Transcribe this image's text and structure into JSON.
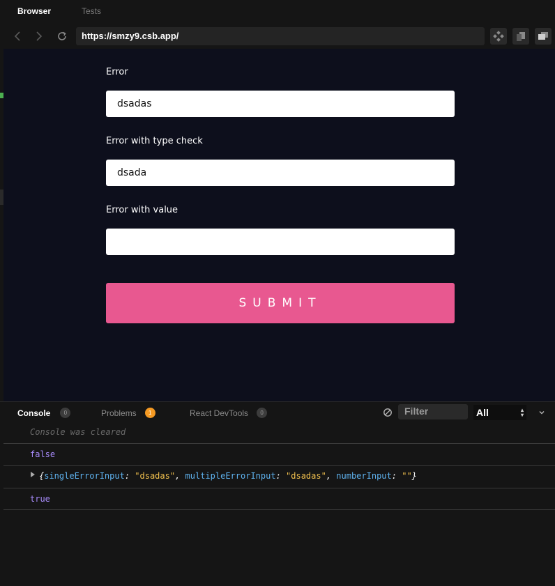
{
  "top_tabs": {
    "browser": "Browser",
    "tests": "Tests"
  },
  "navbar": {
    "url": "https://smzy9.csb.app/"
  },
  "form": {
    "error_label": "Error",
    "error_value": "dsadas",
    "type_check_label": "Error with type check",
    "type_check_value": "dsada",
    "value_label": "Error with value",
    "value_value": "",
    "submit_label": "SUBMIT"
  },
  "console": {
    "tabs": [
      {
        "label": "Console",
        "count": "0"
      },
      {
        "label": "Problems",
        "count": "1"
      },
      {
        "label": "React DevTools",
        "count": "0"
      }
    ],
    "filter_placeholder": "Filter",
    "level": "All",
    "lines": {
      "cleared": "Console was cleared",
      "first": "false",
      "obj_open": "{",
      "k1": "singleErrorInput",
      "v1": "\"dsadas\"",
      "k2": "multipleErrorInput",
      "v2": "\"dsadas\"",
      "k3": "numberInput",
      "v3": "\"\"",
      "obj_close": "}",
      "sep": ", ",
      "colon": ": ",
      "last": "true"
    }
  },
  "colors": {
    "accent": "#e85890",
    "preview_bg": "#0d0f1c",
    "badge_orange": "#f59a23"
  },
  "icons": [
    "back-arrow-icon",
    "forward-arrow-icon",
    "refresh-icon",
    "codesandbox-icon",
    "copy-icon",
    "window-icon",
    "clear-console-icon",
    "chevron-down-icon"
  ]
}
